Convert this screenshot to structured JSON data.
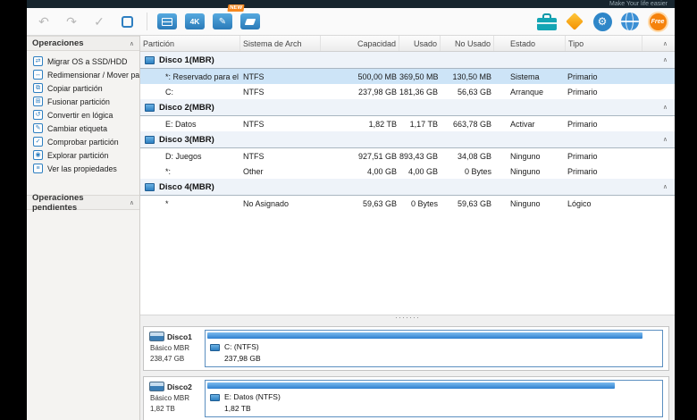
{
  "glyphs": {
    "chevron": "∧",
    "dots": "·······",
    "undo": "↶",
    "redo": "↷",
    "check": "✓",
    "pencil": "✎",
    "gear": "⚙"
  },
  "colors": {
    "accent": "#2e7fc1",
    "selection": "#cde4f7",
    "free_badge": "#f5820c",
    "new_badge": "#f6881f",
    "toolbox": "#13a5b4",
    "diamond": "#f5a623"
  },
  "titlebar": {
    "slogan": "Make Your life easier"
  },
  "toolbar": {
    "align4k_label": "4K",
    "new_badge": "NEW",
    "free_label": "Free"
  },
  "sidebar": {
    "operations_title": "Operaciones",
    "pending_title": "Operaciones pendientes",
    "items": [
      {
        "label": "Migrar OS a SSD/HDD",
        "icon": "migrate-os-icon",
        "glyph": "⇄"
      },
      {
        "label": "Redimensionar / Mover par...",
        "icon": "resize-move-icon",
        "glyph": "↔"
      },
      {
        "label": "Copiar partición",
        "icon": "copy-partition-icon",
        "glyph": "⧉"
      },
      {
        "label": "Fusionar partición",
        "icon": "merge-partition-icon",
        "glyph": "⊞"
      },
      {
        "label": "Convertir en lógica",
        "icon": "convert-logical-icon",
        "glyph": "↺"
      },
      {
        "label": "Cambiar etiqueta",
        "icon": "change-label-icon",
        "glyph": "✎"
      },
      {
        "label": "Comprobar partición",
        "icon": "check-partition-icon",
        "glyph": "✓"
      },
      {
        "label": "Explorar partición",
        "icon": "explore-partition-icon",
        "glyph": "◉"
      },
      {
        "label": "Ver las propiedades",
        "icon": "properties-icon",
        "glyph": "≡"
      }
    ]
  },
  "table": {
    "columns": [
      "Partición",
      "Sistema de Arch",
      "Capacidad",
      "Usado",
      "No Usado",
      "Estado",
      "Tipo"
    ],
    "disks": [
      {
        "name": "Disco 1(MBR)",
        "partitions": [
          {
            "name": "*: Reservado para el sis...",
            "fs": "NTFS",
            "capacity": "500,00 MB",
            "used": "369,50 MB",
            "unused": "130,50 MB",
            "status": "Sistema",
            "type": "Primario",
            "selected": true
          },
          {
            "name": "C:",
            "fs": "NTFS",
            "capacity": "237,98 GB",
            "used": "181,36 GB",
            "unused": "56,63 GB",
            "status": "Arranque",
            "type": "Primario",
            "selected": false
          }
        ]
      },
      {
        "name": "Disco 2(MBR)",
        "partitions": [
          {
            "name": "E: Datos",
            "fs": "NTFS",
            "capacity": "1,82 TB",
            "used": "1,17 TB",
            "unused": "663,78 GB",
            "status": "Activar",
            "type": "Primario",
            "selected": false
          }
        ]
      },
      {
        "name": "Disco 3(MBR)",
        "partitions": [
          {
            "name": "D: Juegos",
            "fs": "NTFS",
            "capacity": "927,51 GB",
            "used": "893,43 GB",
            "unused": "34,08 GB",
            "status": "Ninguno",
            "type": "Primario",
            "selected": false
          },
          {
            "name": "*:",
            "fs": "Other",
            "capacity": "4,00 GB",
            "used": "4,00 GB",
            "unused": "0 Bytes",
            "status": "Ninguno",
            "type": "Primario",
            "selected": false
          }
        ]
      },
      {
        "name": "Disco 4(MBR)",
        "partitions": [
          {
            "name": "*",
            "fs": "No Asignado",
            "capacity": "59,63 GB",
            "used": "0 Bytes",
            "unused": "59,63 GB",
            "status": "Ninguno",
            "type": "Lógico",
            "selected": false
          }
        ]
      }
    ]
  },
  "disk_panel": {
    "disks": [
      {
        "name": "Disco1",
        "kind": "Básico MBR",
        "size": "238,47 GB",
        "partition_label": "C: (NTFS)",
        "partition_size": "237,98 GB",
        "fill_pct": 96
      },
      {
        "name": "Disco2",
        "kind": "Básico MBR",
        "size": "1,82 TB",
        "partition_label": "E: Datos (NTFS)",
        "partition_size": "1,82 TB",
        "fill_pct": 90
      }
    ]
  }
}
